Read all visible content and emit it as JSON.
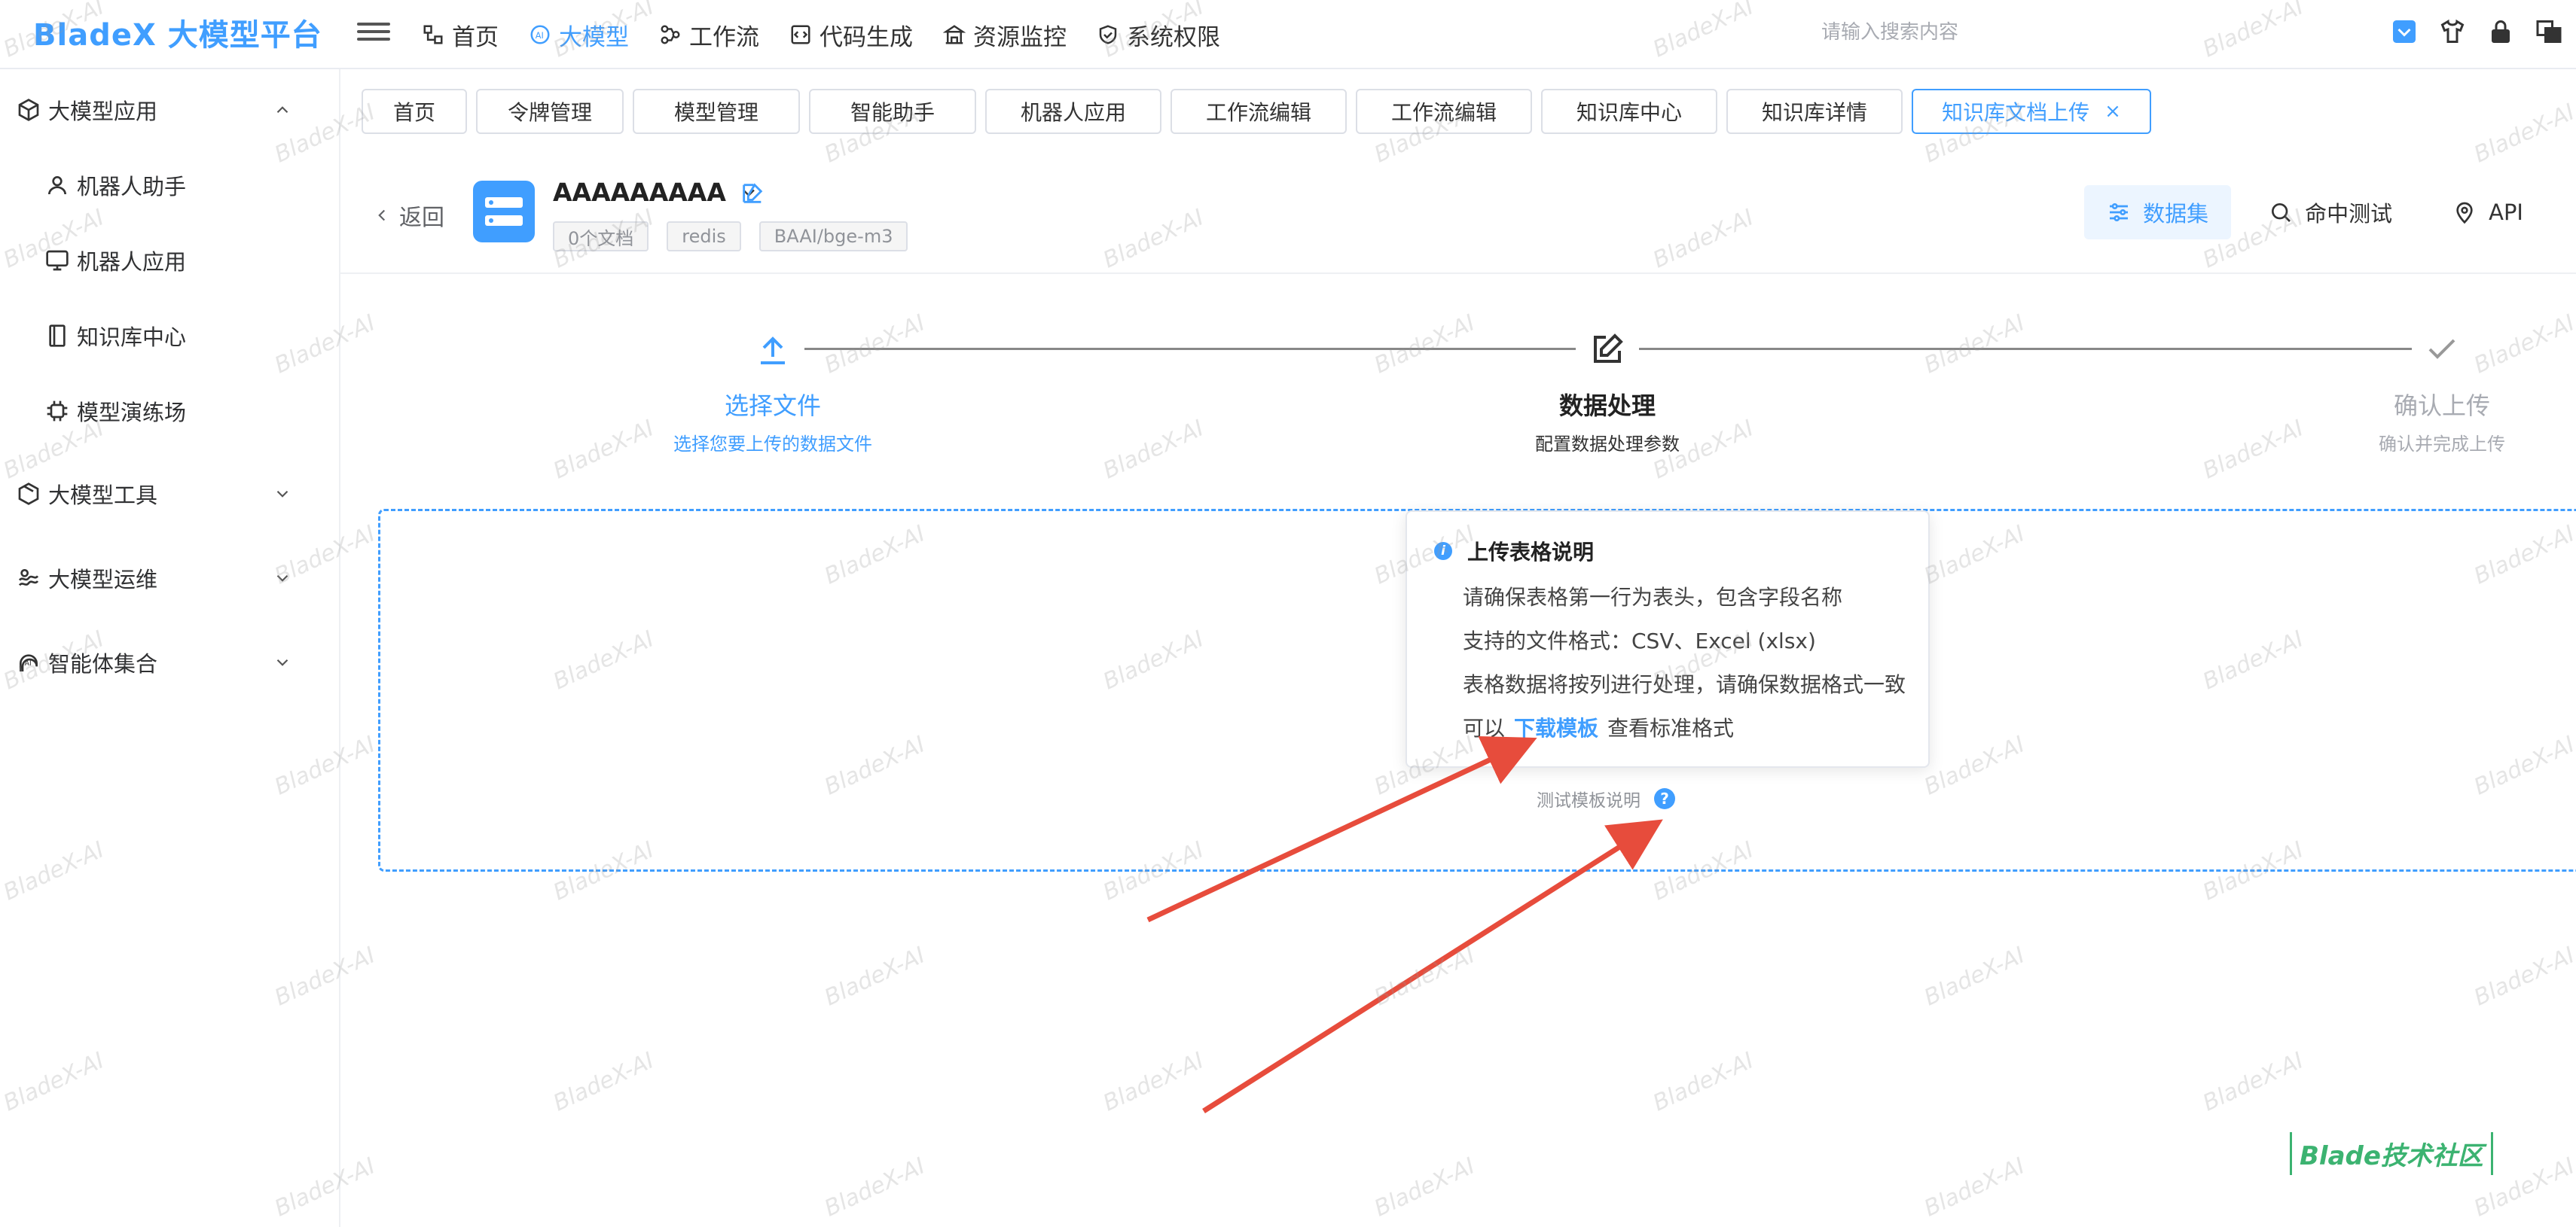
{
  "app": {
    "logo": "BladeX 大模型平台"
  },
  "topnav": [
    {
      "label": "首页",
      "icon": "home-icon",
      "active": false
    },
    {
      "label": "大模型",
      "icon": "ai-icon",
      "active": true
    },
    {
      "label": "工作流",
      "icon": "workflow-icon",
      "active": false
    },
    {
      "label": "代码生成",
      "icon": "code-icon",
      "active": false
    },
    {
      "label": "资源监控",
      "icon": "monitor-icon",
      "active": false
    },
    {
      "label": "系统权限",
      "icon": "shield-icon",
      "active": false
    }
  ],
  "search": {
    "placeholder": "请输入搜索内容"
  },
  "sidebar": {
    "group1": {
      "label": "大模型应用",
      "icon": "cube-icon"
    },
    "items": [
      {
        "label": "机器人助手",
        "icon": "user-icon"
      },
      {
        "label": "机器人应用",
        "icon": "monitor-icon"
      },
      {
        "label": "知识库中心",
        "icon": "book-icon"
      },
      {
        "label": "模型演练场",
        "icon": "chip-icon"
      }
    ],
    "group2": {
      "label": "大模型工具",
      "icon": "box-icon"
    },
    "group3": {
      "label": "大模型运维",
      "icon": "ops-icon"
    },
    "group4": {
      "label": "智能体集合",
      "icon": "agent-icon"
    }
  },
  "tabs": [
    {
      "label": "首页"
    },
    {
      "label": "令牌管理"
    },
    {
      "label": "模型管理"
    },
    {
      "label": "智能助手"
    },
    {
      "label": "机器人应用"
    },
    {
      "label": "工作流编辑"
    },
    {
      "label": "工作流编辑"
    },
    {
      "label": "知识库中心"
    },
    {
      "label": "知识库详情"
    },
    {
      "label": "知识库文档上传",
      "active": true,
      "close": "×"
    }
  ],
  "header": {
    "back": "返回",
    "kb_name": "AAAAAAAAA",
    "chips": [
      "0个文档",
      "redis",
      "BAAI/bge-m3"
    ],
    "actions": [
      {
        "label": "数据集",
        "icon": "sliders-icon",
        "active": true
      },
      {
        "label": "命中测试",
        "icon": "search-icon",
        "active": false
      },
      {
        "label": "API",
        "icon": "location-icon",
        "active": false
      }
    ]
  },
  "steps": [
    {
      "title": "选择文件",
      "desc": "选择您要上传的数据文件",
      "state": "active"
    },
    {
      "title": "数据处理",
      "desc": "配置数据处理参数",
      "state": "bold"
    },
    {
      "title": "确认上传",
      "desc": "确认并完成上传",
      "state": "pending"
    }
  ],
  "popover": {
    "title": "上传表格说明",
    "lines": [
      "请确保表格第一行为表头，包含字段名称",
      "支持的文件格式：CSV、Excel (xlsx)",
      "表格数据将按列进行处理，请确保数据格式一致"
    ],
    "last_prefix": "可以",
    "link": "下载模板",
    "last_suffix": "查看标准格式"
  },
  "template_label": "测试模板说明",
  "template_help": "?",
  "watermark": "BladeX-AI",
  "community": "Blade技术社区",
  "colors": {
    "primary": "#409eff",
    "arrow": "#e74c3c"
  }
}
